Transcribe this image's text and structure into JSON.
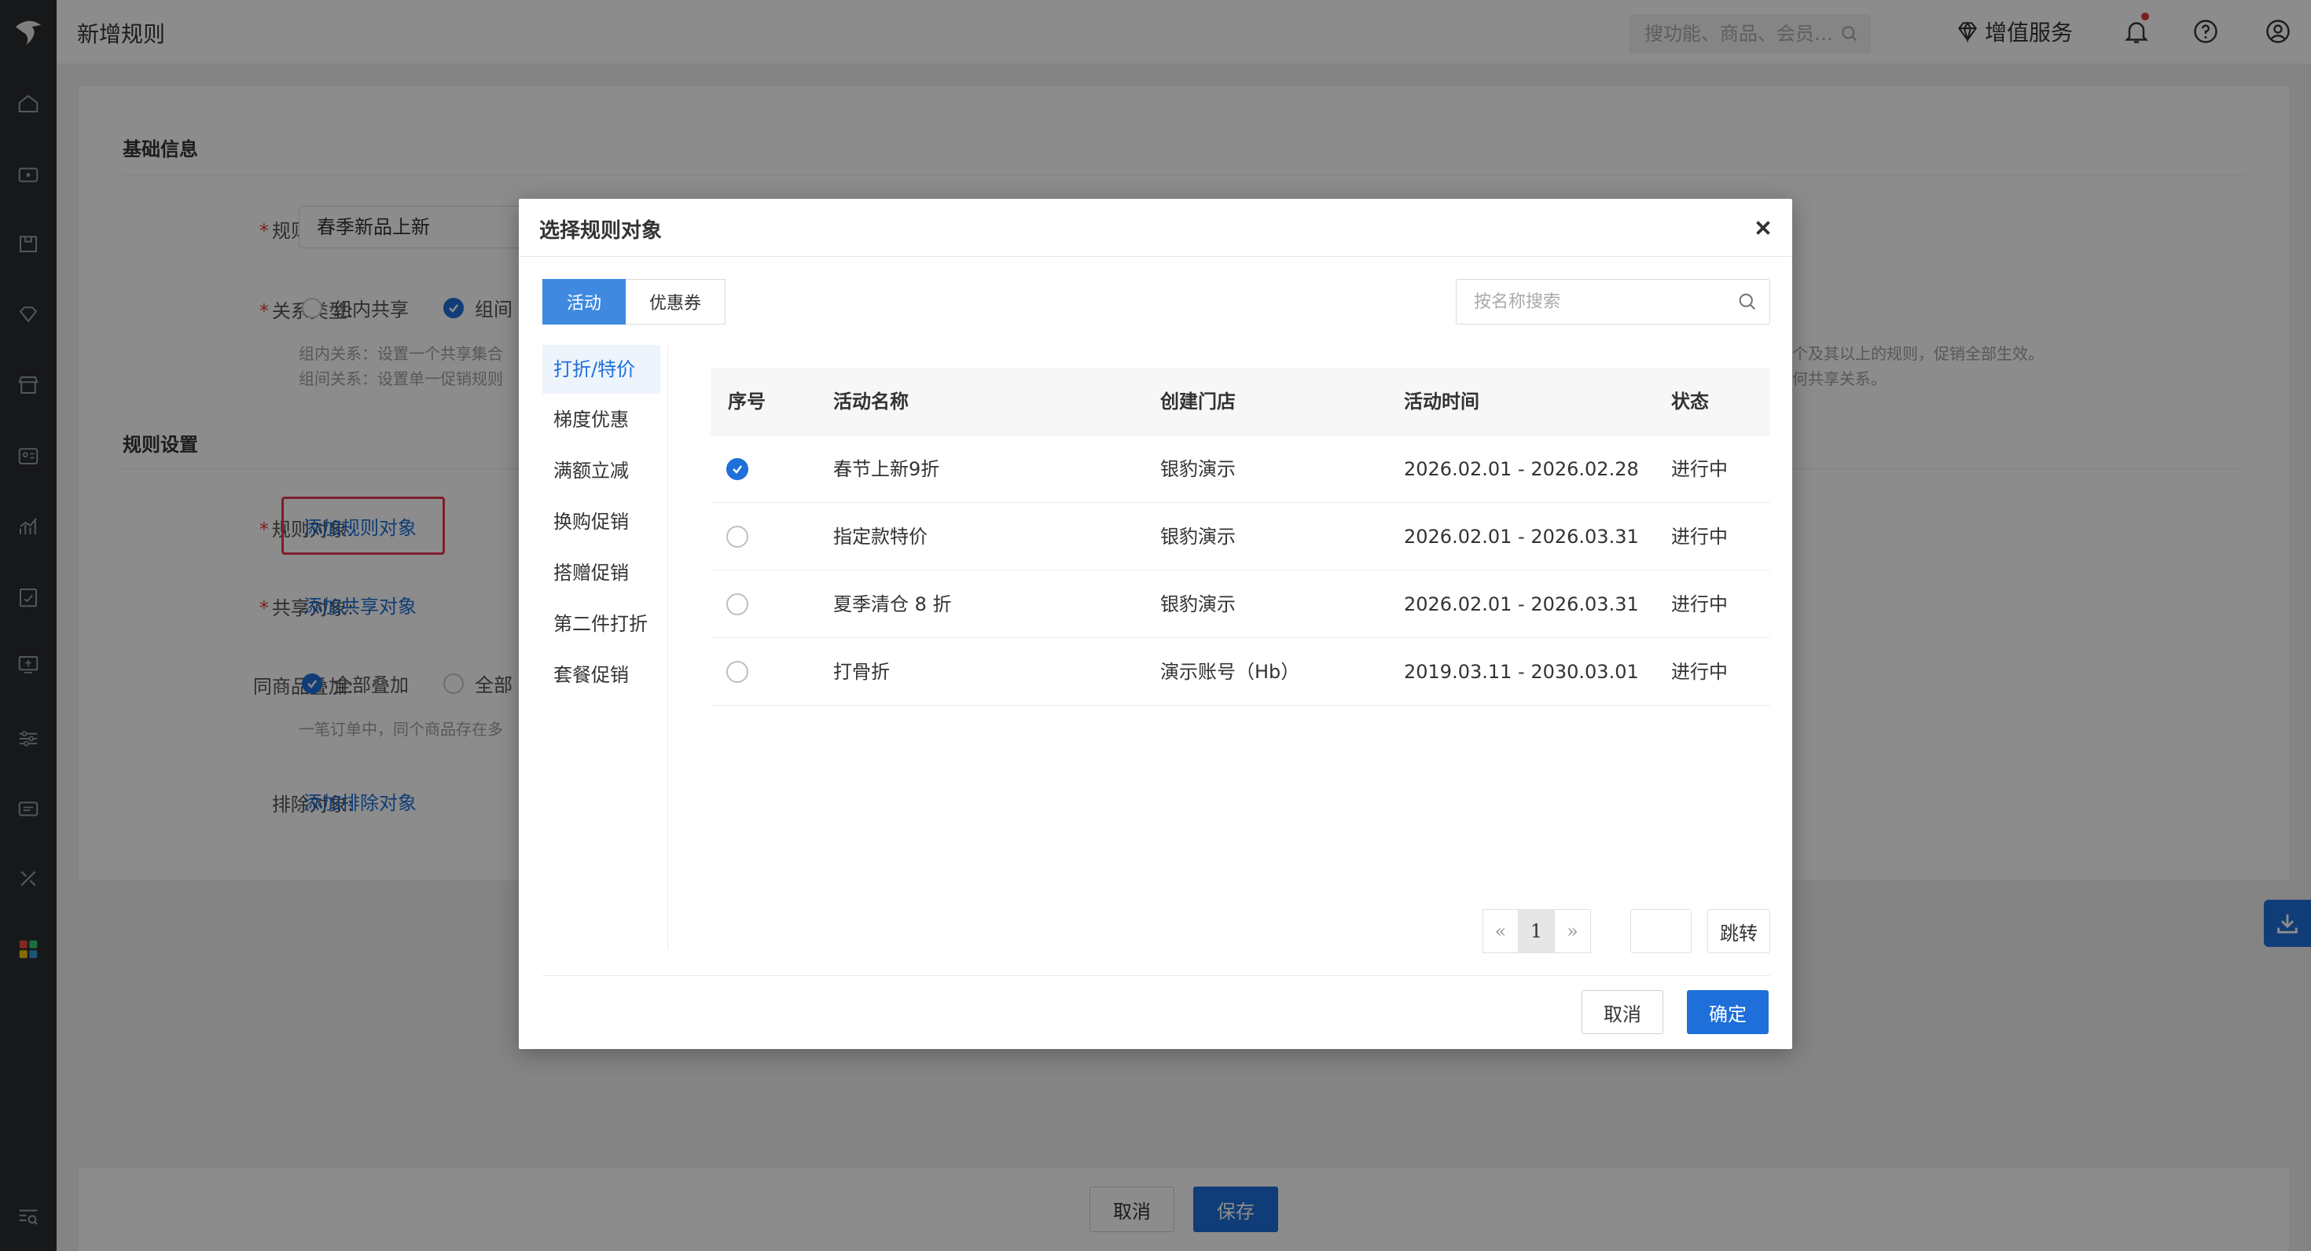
{
  "header": {
    "title": "新增规则",
    "search_placeholder": "搜功能、商品、会员…",
    "value_added_service": "增值服务"
  },
  "colors": {
    "primary": "#1e6fd9",
    "highlight_border": "#e53950",
    "rail_bg": "#2b2d31"
  },
  "rail_icons": [
    "logo-icon",
    "home-icon",
    "wallet-icon",
    "box-icon",
    "diamond-icon",
    "store-icon",
    "member-card-icon",
    "chart-icon",
    "report-icon",
    "finance-icon",
    "settings-sliders-icon",
    "message-icon",
    "tools-icon",
    "apps-grid-icon",
    "search-list-icon"
  ],
  "form": {
    "basic_section": "基础信息",
    "rule_name_label": "规则名称:",
    "rule_name_value": "春季新品上新",
    "relation_label": "关系类型:",
    "relation_options": [
      "组内共享",
      "组间"
    ],
    "help_line1_left": "组内关系：设置一个共享集合",
    "help_line1_right": "个及其以上的规则，促销全部生效。",
    "help_line2_left": "组间关系：设置单一促销规则",
    "help_line2_right": "何共享关系。",
    "rule_section": "规则设置",
    "rule_object_label": "规则对象:",
    "rule_object_link": "添加规则对象",
    "share_object_label": "共享对象:",
    "share_object_link": "添加共享对象",
    "stack_label": "同商品叠加:",
    "stack_options": [
      "全部叠加",
      "全部"
    ],
    "stack_help": "一笔订单中，同个商品存在多",
    "exclude_label": "排除对象:",
    "exclude_link": "添加排除对象"
  },
  "footer": {
    "cancel": "取消",
    "save": "保存"
  },
  "modal": {
    "title": "选择规则对象",
    "tabs": [
      {
        "label": "活动",
        "active": true
      },
      {
        "label": "优惠券",
        "active": false
      }
    ],
    "search_placeholder": "按名称搜索",
    "categories": [
      "打折/特价",
      "梯度优惠",
      "满额立减",
      "换购促销",
      "搭赠促销",
      "第二件打折",
      "套餐促销"
    ],
    "active_category": "打折/特价",
    "columns": [
      "序号",
      "活动名称",
      "创建门店",
      "活动时间",
      "状态"
    ],
    "rows": [
      {
        "selected": true,
        "name": "春节上新9折",
        "store": "银豹演示",
        "time": "2026.02.01 - 2026.02.28",
        "status": "进行中"
      },
      {
        "selected": false,
        "name": "指定款特价",
        "store": "银豹演示",
        "time": "2026.02.01 - 2026.03.31",
        "status": "进行中"
      },
      {
        "selected": false,
        "name": "夏季清仓 8 折",
        "store": "银豹演示",
        "time": "2026.02.01 - 2026.03.31",
        "status": "进行中"
      },
      {
        "selected": false,
        "name": "打骨折",
        "store": "演示账号（Hb）",
        "time": "2019.03.11 - 2030.03.01",
        "status": "进行中"
      }
    ],
    "pagination": {
      "prev": "«",
      "current": "1",
      "next": "»",
      "jump": "跳转"
    },
    "cancel": "取消",
    "confirm": "确定"
  }
}
